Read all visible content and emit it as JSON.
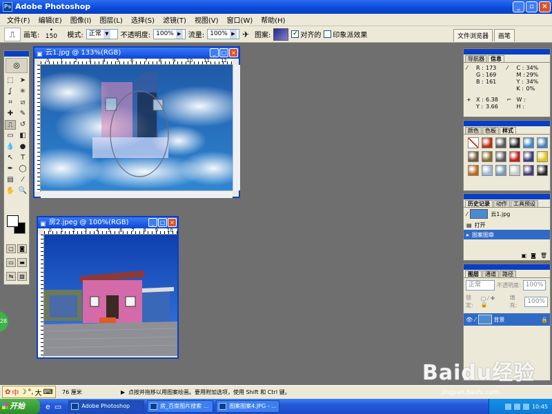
{
  "app": {
    "title": "Adobe Photoshop"
  },
  "menu": [
    "文件(F)",
    "编辑(E)",
    "图像(I)",
    "图层(L)",
    "选择(S)",
    "滤镜(T)",
    "视图(V)",
    "窗口(W)",
    "帮助(H)"
  ],
  "options": {
    "brush_label": "画笔:",
    "brush_size": "150",
    "mode_label": "模式:",
    "mode_value": "正常",
    "opacity_label": "不透明度:",
    "opacity_value": "100%",
    "flow_label": "流量:",
    "flow_value": "100%",
    "pattern_label": "图案:",
    "aligned_label": "对齐的",
    "impressionist_label": "印象派效果",
    "aligned_checked": true,
    "impressionist_checked": false,
    "palette_tabs": [
      "文件浏览器",
      "画笔"
    ]
  },
  "doc1": {
    "title": "云1.jpg @ 133%(RGB)",
    "ruler": [
      "0",
      "1",
      "2",
      "3",
      "4",
      "5",
      "6",
      "7",
      "8",
      "9",
      "10",
      "11",
      "12"
    ]
  },
  "doc2": {
    "title": "房2.jpeg @ 100%(RGB)",
    "ruler": [
      "0",
      "1",
      "2",
      "3",
      "4",
      "5",
      "6",
      "7",
      "8",
      "9",
      "10"
    ]
  },
  "navinfo": {
    "tabs": [
      "导航器",
      "信息"
    ],
    "rgb": [
      [
        "R :",
        "173"
      ],
      [
        "G :",
        "169"
      ],
      [
        "B :",
        "161"
      ]
    ],
    "cmyk": [
      [
        "C :",
        "34%"
      ],
      [
        "M :",
        "29%"
      ],
      [
        "Y :",
        "34%"
      ],
      [
        "K :",
        "0%"
      ]
    ],
    "xy": [
      [
        "X :",
        "6.38"
      ],
      [
        "Y :",
        "3.66"
      ]
    ],
    "wh": [
      [
        "W :",
        ""
      ],
      [
        "H :",
        ""
      ]
    ]
  },
  "styles_panel": {
    "tabs": [
      "颜色",
      "色板",
      "样式"
    ],
    "swatches": [
      "#ffffff",
      "#c02a10",
      "#5a5a5a",
      "#2a2a2a",
      "#3f86c8",
      "#4a7fbf",
      "#6b5a40",
      "#8a6a30",
      "#5c5c5c",
      "#c41c1c",
      "#3a3a7a",
      "#e6c21a",
      "#b86a1e",
      "#9ab8d8",
      "#7a9ab8",
      "#c8c8c8",
      "#4a3a7a",
      "#2a2a2a"
    ]
  },
  "history": {
    "tabs": [
      "历史记录",
      "动作",
      "工具预设"
    ],
    "snapshot": "云1.jpg",
    "items": [
      "打开",
      "图案图章"
    ]
  },
  "layers": {
    "tabs": [
      "图层",
      "通道",
      "路径"
    ],
    "blend": "正常",
    "opacity_label": "不透明度:",
    "opacity_value": "100%",
    "lock_label": "锁定:",
    "fill_label": "填充:",
    "fill_value": "100%",
    "layer_name": "背景"
  },
  "status": {
    "ime": "中",
    "size": "76 厘米",
    "hint": "点按并拖移以用图案绘画。要用附加选项，使用 Shift 和 Ctrl 键。"
  },
  "taskbar": {
    "start": "开始",
    "tasks": [
      "Adobe Photoshop",
      "房_百度图片搜索 ...",
      "图案图案4.JPG - ..."
    ],
    "clock": "10:45"
  },
  "watermark": {
    "main": "Baidu经验",
    "sub": "jingyan.baidu.com"
  },
  "badge": "28"
}
